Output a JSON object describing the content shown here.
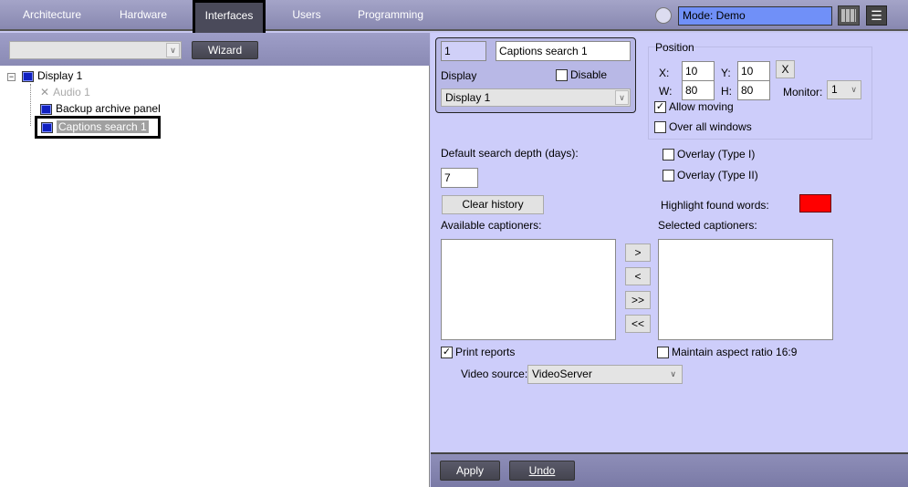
{
  "nav": {
    "tabs": [
      "Architecture",
      "Hardware",
      "Interfaces",
      "Users",
      "Programming"
    ],
    "active": "Interfaces",
    "mode": "Mode: Demo"
  },
  "left_toolbar": {
    "combo_value": "",
    "wizard": "Wizard"
  },
  "tree": {
    "root": "Display 1",
    "children": [
      {
        "label": "Audio 1",
        "disabled": true
      },
      {
        "label": "Backup archive panel"
      },
      {
        "label": "Captions search 1",
        "selected": true
      }
    ]
  },
  "object": {
    "id": "1",
    "name": "Captions search 1",
    "display_label": "Display",
    "disable_label": "Disable",
    "display_value": "Display 1"
  },
  "position": {
    "title": "Position",
    "x_label": "X:",
    "x": "10",
    "y_label": "Y:",
    "y": "10",
    "w_label": "W:",
    "w": "80",
    "h_label": "H:",
    "h": "80",
    "x_button": "X",
    "monitor_label": "Monitor:",
    "monitor": "1",
    "allow_moving": "Allow moving",
    "over_all": "Over all windows"
  },
  "settings": {
    "depth_label": "Default search depth (days):",
    "depth": "7",
    "clear_history": "Clear history",
    "overlay1": "Overlay (Type I)",
    "overlay2": "Overlay (Type II)",
    "highlight_label": "Highlight found words:",
    "highlight_color": "#ff0000",
    "available": "Available captioners:",
    "selected": "Selected captioners:",
    "move_right": ">",
    "move_left": "<",
    "move_all_right": ">>",
    "move_all_left": "<<",
    "print_reports": "Print reports",
    "aspect": "Maintain aspect ratio 16:9",
    "video_source_label": "Video source:",
    "video_source": "VideoServer"
  },
  "footer": {
    "apply": "Apply",
    "undo": "Undo"
  }
}
